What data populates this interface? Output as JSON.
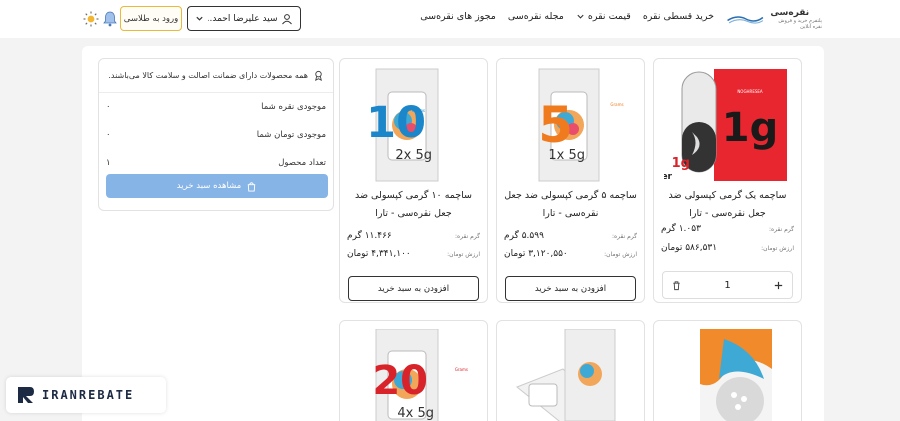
{
  "header": {
    "logo": {
      "title": "نقره‌سی",
      "subtitle": "پلتفرم خرید و فروش نقره آنلاین"
    },
    "nav": [
      "خرید قسطی نقره",
      "قیمت نقره",
      "مجله نقره‌سی",
      "مجوز های نقره‌سی"
    ],
    "user_name": "سید علیرضا احمد...",
    "gold_login": "ورود به طلاسی"
  },
  "summary": {
    "guarantee": "همه محصولات دارای ضمانت اصالت و سلامت کالا می‌باشند.",
    "rows": [
      {
        "label": "موجودی نقره شما",
        "value": "۰"
      },
      {
        "label": "موجودی تومان شما",
        "value": "۰"
      },
      {
        "label": "تعداد محصول",
        "value": "۱"
      }
    ],
    "view_cart": "مشاهده سبد خرید"
  },
  "labels": {
    "silver_weight": "گرم نقره:",
    "toman_value": "ارزش تومان:",
    "gram_unit": "گرم",
    "toman_unit": "تومان",
    "add_to_cart": "افزودن به سبد خرید"
  },
  "products": [
    {
      "title": "ساچمه یک گرمی کپسولی ضد جعل نقره‌سی - تارا",
      "weight": "۱.۰۵۳",
      "price": "۵۸۶,۵۳۱",
      "quantity": "1",
      "in_cart": true,
      "badge": {
        "big": "1g",
        "small": "Silver",
        "brand": "NOGHRESEA"
      }
    },
    {
      "title": "ساچمه ۵ گرمی کپسولی ضد جعل نقره‌سی - تارا",
      "weight": "۵.۵۹۹",
      "price": "۳,۱۲۰,۵۵۰",
      "in_cart": false,
      "badge": {
        "big": "5",
        "small": "1x 5g",
        "tag": "Grams"
      }
    },
    {
      "title": "ساچمه ۱۰ گرمی کپسولی ضد جعل نقره‌سی - تارا",
      "weight": "۱۱.۴۶۶",
      "price": "۴,۳۴۱,۱۰۰",
      "in_cart": false,
      "badge": {
        "big": "10",
        "small": "2x 5g",
        "tag": "Grams"
      }
    },
    {
      "badge": {}
    },
    {
      "badge": {}
    },
    {
      "badge": {
        "big": "20",
        "small": "4x 5g",
        "tag": "Grams"
      }
    }
  ],
  "watermark": "IRANREBATE",
  "colors": {
    "accent": "#86b4e6",
    "gold": "#e8b93b",
    "red": "#d8232a",
    "blue": "#1b86c9",
    "orange": "#f07a1e"
  }
}
